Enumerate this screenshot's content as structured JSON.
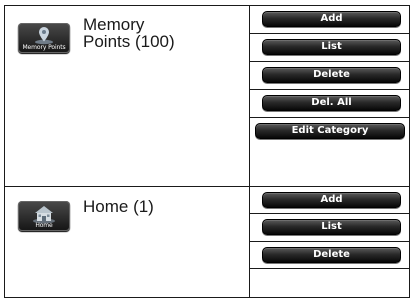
{
  "memory_points": {
    "icon_caption": "Memory Points",
    "title_line1": "Memory",
    "title_line2": "Points (100)",
    "buttons": {
      "add": "Add",
      "list": "List",
      "delete": "Delete",
      "del_all": "Del. All",
      "edit_category": "Edit Category"
    }
  },
  "home": {
    "icon_caption": "Home",
    "title": "Home (1)",
    "buttons": {
      "add": "Add",
      "list": "List",
      "delete": "Delete"
    }
  },
  "colors": {
    "border": "#1a1a1a",
    "button_top": "#5a5a5a",
    "button_bottom": "#080808",
    "button_text": "#ffffff"
  },
  "icons": {
    "memory_points": "map-pin-icon",
    "home": "house-icon"
  }
}
